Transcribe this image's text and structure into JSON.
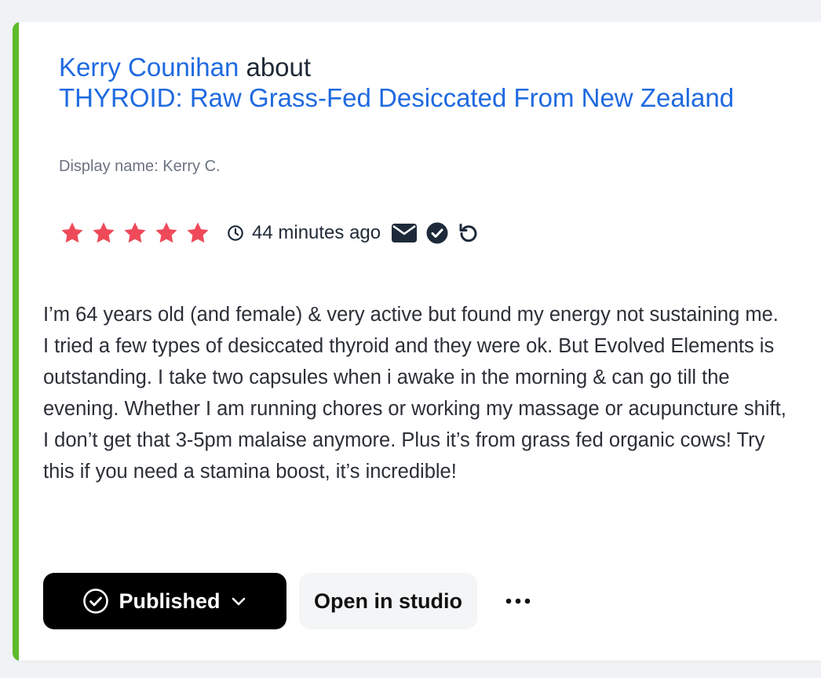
{
  "review": {
    "author": "Kerry Counihan",
    "connector": "about",
    "product": "THYROID: Raw Grass-Fed Desiccated From New Zealand",
    "display_name": "Display name: Kerry C.",
    "rating": 5,
    "time_ago": "44 minutes ago",
    "body": "I’m 64 years old (and female) & very active but found my energy not sustaining me. I tried a few types of desiccated thyroid and they were ok. But Evolved Elements is outstanding. I take two capsules when i awake in the morning & can go till the evening. Whether I am running chores or working my massage or acupuncture shift, I don’t get that 3-5pm malaise anymore. Plus it’s from grass fed organic cows! Try this if you need a stamina boost, it’s incredible!"
  },
  "meta_icons": [
    "envelope-icon",
    "check-circle-icon",
    "undo-icon"
  ],
  "actions": {
    "status_label": "Published",
    "studio_label": "Open in studio",
    "more_label": "•••"
  },
  "colors": {
    "accent": "#5dbb2b",
    "link": "#1f6ae0",
    "star": "#ef4a5a",
    "icon": "#1e2a3a"
  }
}
